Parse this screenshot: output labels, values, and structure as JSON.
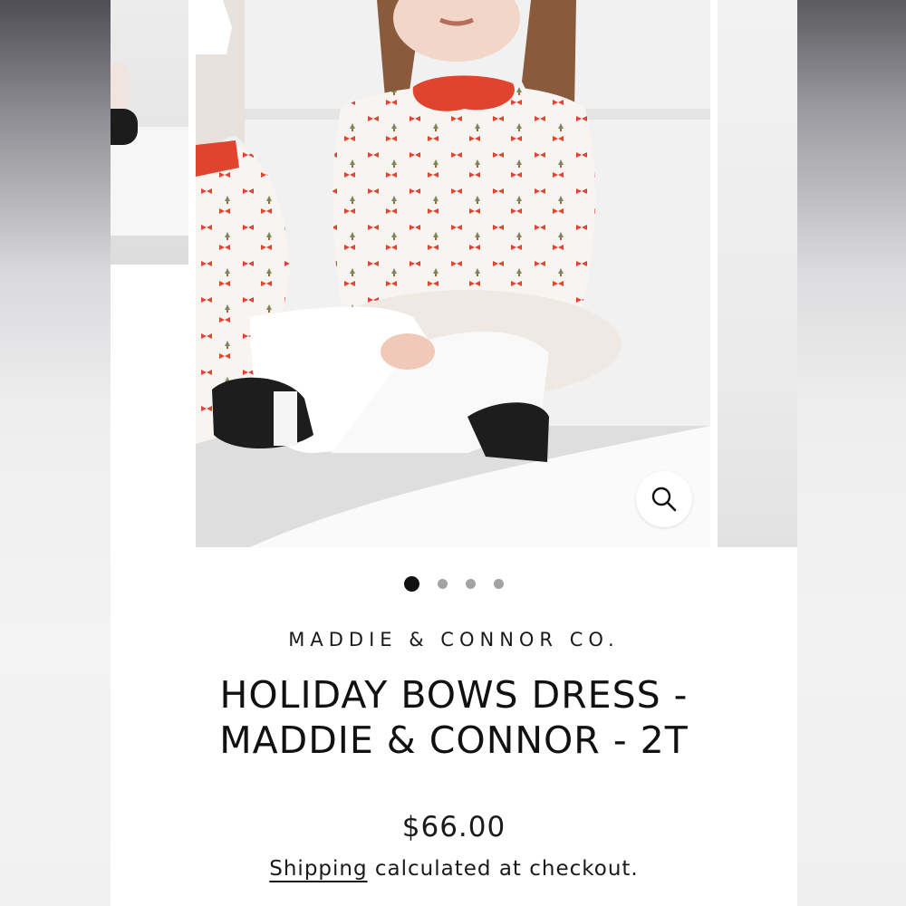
{
  "product_gallery": {
    "images": [
      {
        "alt": "previous product photo"
      },
      {
        "alt": "girl wearing holiday bows dress with red collar"
      },
      {
        "alt": "next product photo"
      }
    ],
    "zoom_icon": "search-icon",
    "slide_count": 4,
    "active_slide": 1
  },
  "product": {
    "vendor": "MADDIE & CONNOR CO.",
    "title": "HOLIDAY BOWS DRESS - MADDIE & CONNOR - 2T",
    "price": "$66.00",
    "shipping_link": "Shipping",
    "shipping_text": " calculated at checkout."
  },
  "colors": {
    "collar_red": "#e0432e",
    "text": "#111111"
  }
}
